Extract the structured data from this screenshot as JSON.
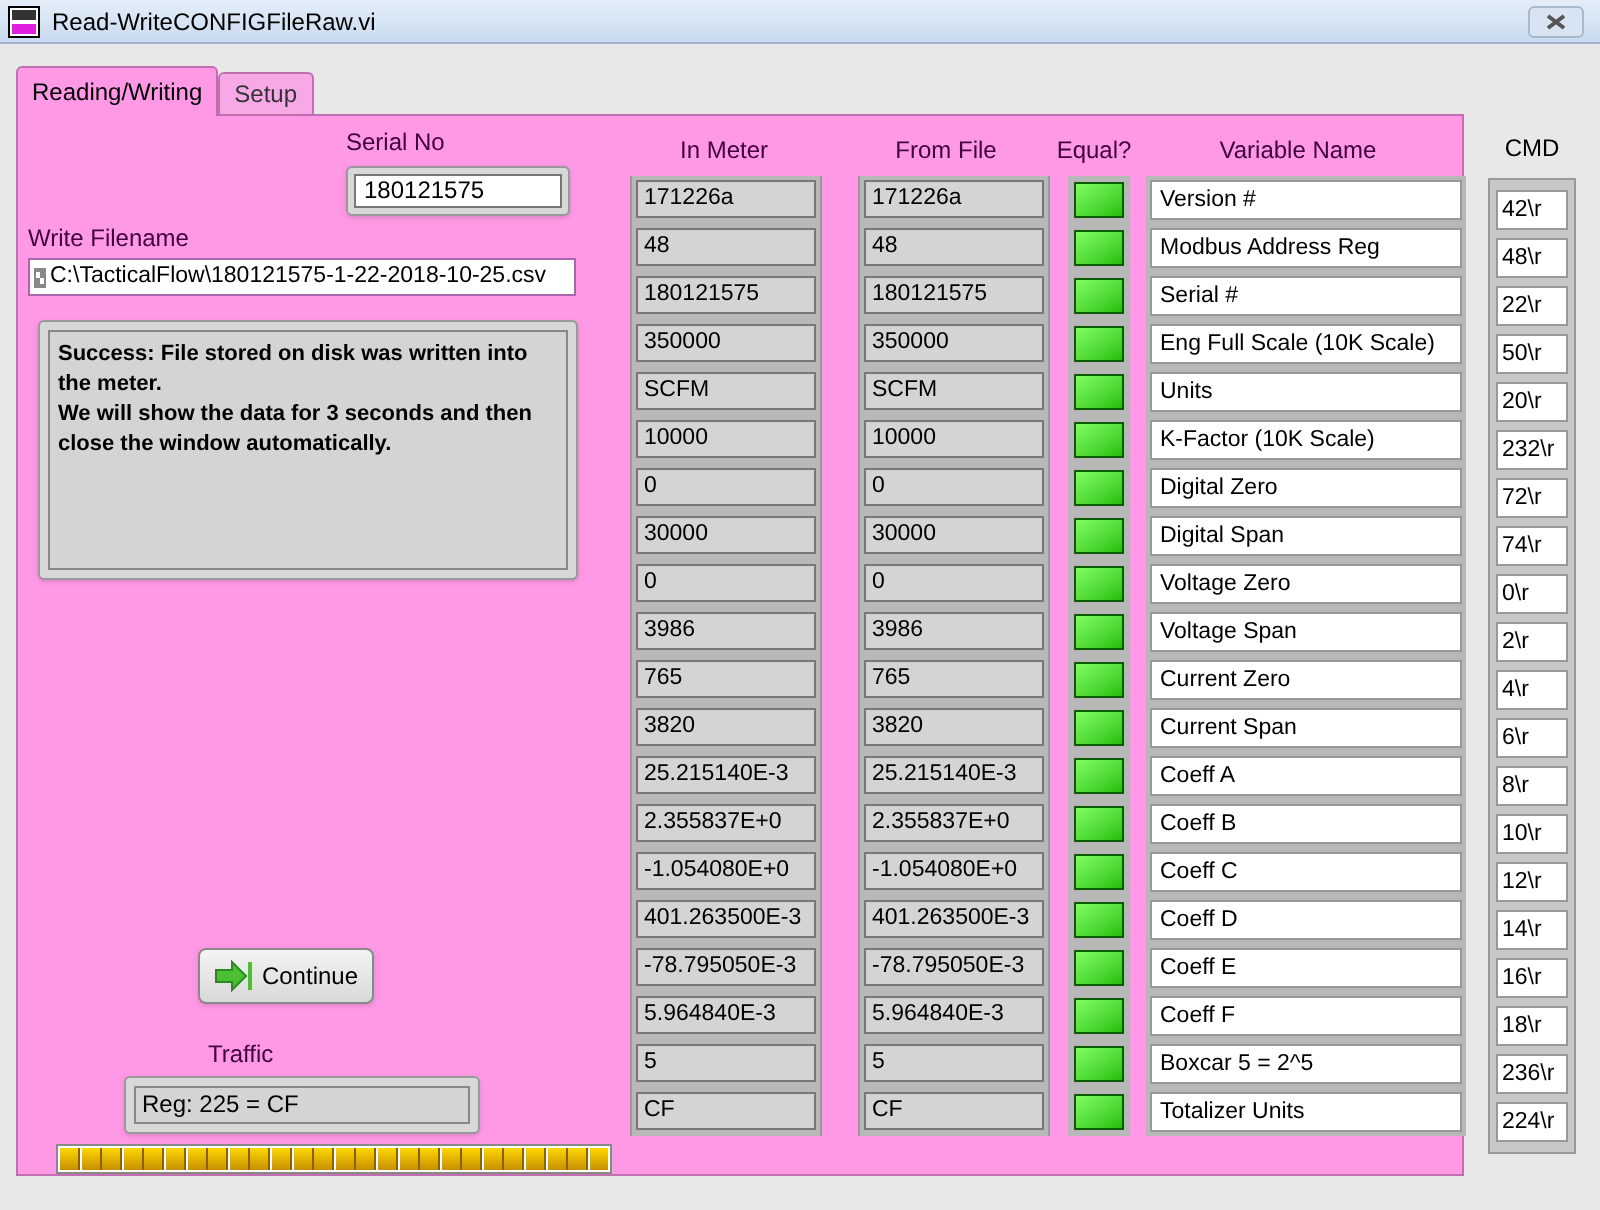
{
  "window": {
    "title": "Read-WriteCONFIGFileRaw.vi"
  },
  "tabs": [
    {
      "label": "Reading/Writing",
      "selected": true
    },
    {
      "label": "Setup",
      "selected": false
    }
  ],
  "serial_no": {
    "label": "Serial No",
    "value": "180121575"
  },
  "write_filename": {
    "label": "Write Filename",
    "value": "C:\\TacticalFlow\\180121575-1-22-2018-10-25.csv"
  },
  "message": [
    "Success: File stored on disk was written into the meter.",
    "We will show the data for 3 seconds and then close the window automatically."
  ],
  "continue_button": "Continue",
  "traffic": {
    "label": "Traffic",
    "value": "Reg: 225 = CF",
    "level": 1
  },
  "columns": {
    "in_meter": "In Meter",
    "from_file": "From File",
    "equal": "Equal?",
    "variable_name": "Variable Name",
    "cmd": "CMD"
  },
  "rows": [
    {
      "in_meter": "171226a",
      "from_file": "171226a",
      "equal": true,
      "variable_name": "Version #",
      "cmd": "42\\r"
    },
    {
      "in_meter": "48",
      "from_file": "48",
      "equal": true,
      "variable_name": "Modbus Address Reg",
      "cmd": "48\\r"
    },
    {
      "in_meter": "180121575",
      "from_file": "180121575",
      "equal": true,
      "variable_name": "Serial #",
      "cmd": "22\\r"
    },
    {
      "in_meter": "350000",
      "from_file": "350000",
      "equal": true,
      "variable_name": "Eng Full Scale (10K Scale)",
      "cmd": "50\\r"
    },
    {
      "in_meter": "SCFM",
      "from_file": "SCFM",
      "equal": true,
      "variable_name": "Units",
      "cmd": "20\\r"
    },
    {
      "in_meter": "10000",
      "from_file": "10000",
      "equal": true,
      "variable_name": "K-Factor (10K Scale)",
      "cmd": "232\\r"
    },
    {
      "in_meter": "0",
      "from_file": "0",
      "equal": true,
      "variable_name": "Digital Zero",
      "cmd": "72\\r"
    },
    {
      "in_meter": "30000",
      "from_file": "30000",
      "equal": true,
      "variable_name": "Digital Span",
      "cmd": "74\\r"
    },
    {
      "in_meter": "0",
      "from_file": "0",
      "equal": true,
      "variable_name": "Voltage Zero",
      "cmd": "0\\r"
    },
    {
      "in_meter": "3986",
      "from_file": "3986",
      "equal": true,
      "variable_name": "Voltage Span",
      "cmd": "2\\r"
    },
    {
      "in_meter": "765",
      "from_file": "765",
      "equal": true,
      "variable_name": "Current Zero",
      "cmd": "4\\r"
    },
    {
      "in_meter": "3820",
      "from_file": "3820",
      "equal": true,
      "variable_name": "Current Span",
      "cmd": "6\\r"
    },
    {
      "in_meter": "25.215140E-3",
      "from_file": "25.215140E-3",
      "equal": true,
      "variable_name": "Coeff A",
      "cmd": "8\\r"
    },
    {
      "in_meter": "2.355837E+0",
      "from_file": "2.355837E+0",
      "equal": true,
      "variable_name": "Coeff B",
      "cmd": "10\\r"
    },
    {
      "in_meter": "-1.054080E+0",
      "from_file": "-1.054080E+0",
      "equal": true,
      "variable_name": "Coeff C",
      "cmd": "12\\r"
    },
    {
      "in_meter": "401.263500E-3",
      "from_file": "401.263500E-3",
      "equal": true,
      "variable_name": "Coeff D",
      "cmd": "14\\r"
    },
    {
      "in_meter": "-78.795050E-3",
      "from_file": "-78.795050E-3",
      "equal": true,
      "variable_name": "Coeff E",
      "cmd": "16\\r"
    },
    {
      "in_meter": "5.964840E-3",
      "from_file": "5.964840E-3",
      "equal": true,
      "variable_name": "Coeff F",
      "cmd": "18\\r"
    },
    {
      "in_meter": "5",
      "from_file": "5",
      "equal": true,
      "variable_name": "Boxcar 5 = 2^5",
      "cmd": "236\\r"
    },
    {
      "in_meter": "CF",
      "from_file": "CF",
      "equal": true,
      "variable_name": "Totalizer Units",
      "cmd": "224\\r"
    }
  ]
}
